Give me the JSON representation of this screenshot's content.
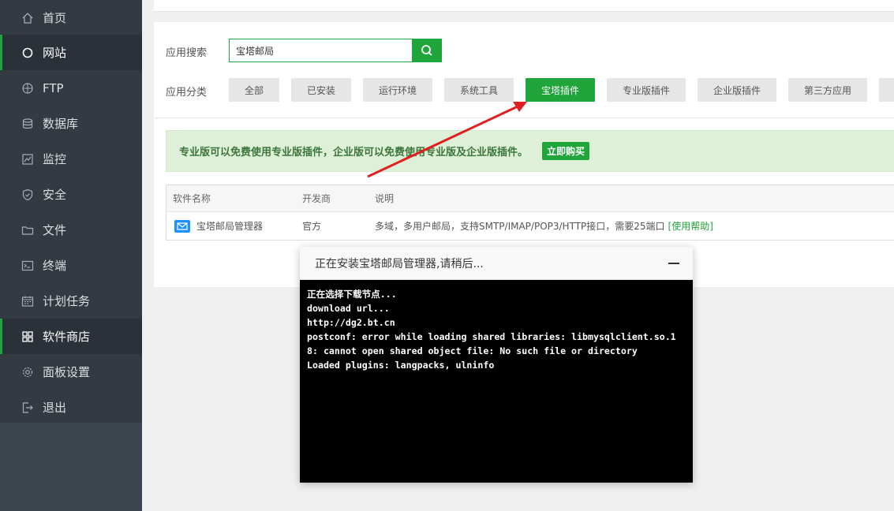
{
  "sidebar": {
    "items": [
      {
        "label": "首页",
        "icon": "home-icon"
      },
      {
        "label": "网站",
        "icon": "globe-icon",
        "active": true
      },
      {
        "label": "FTP",
        "icon": "ftp-icon"
      },
      {
        "label": "数据库",
        "icon": "database-icon"
      },
      {
        "label": "监控",
        "icon": "monitor-icon"
      },
      {
        "label": "安全",
        "icon": "shield-icon"
      },
      {
        "label": "文件",
        "icon": "folder-icon"
      },
      {
        "label": "终端",
        "icon": "terminal-icon"
      },
      {
        "label": "计划任务",
        "icon": "calendar-icon"
      },
      {
        "label": "软件商店",
        "icon": "apps-icon",
        "active": true
      },
      {
        "label": "面板设置",
        "icon": "gear-icon"
      },
      {
        "label": "退出",
        "icon": "logout-icon"
      }
    ]
  },
  "search": {
    "label": "应用搜索",
    "value": "宝塔邮局"
  },
  "categories": {
    "label": "应用分类",
    "items": [
      "全部",
      "已安装",
      "运行环境",
      "系统工具",
      "宝塔插件",
      "专业版插件",
      "企业版插件",
      "第三方应用"
    ],
    "selected": "宝塔插件"
  },
  "notice": {
    "text": "专业版可以免费使用专业版插件，企业版可以免费使用专业版及企业版插件。",
    "buy_label": "立即购买"
  },
  "table": {
    "headers": [
      "软件名称",
      "开发商",
      "说明"
    ],
    "rows": [
      {
        "name": "宝塔邮局管理器",
        "developer": "官方",
        "desc": "多域，多用户邮局，支持SMTP/IMAP/POP3/HTTP接口，需要25端口",
        "help": "[使用帮助]"
      }
    ]
  },
  "dialog": {
    "title": "正在安装宝塔邮局管理器,请稍后...",
    "log": "正在选择下载节点...\ndownload url...\nhttp://dg2.bt.cn\npostconf: error while loading shared libraries: libmysqlclient.so.18: cannot open shared object file: No such file or directory\nLoaded plugins: langpacks, ulninfo"
  },
  "colors": {
    "brand_green": "#20a53a",
    "sidebar_bg": "#333a41",
    "arrow_red": "#e02020"
  }
}
